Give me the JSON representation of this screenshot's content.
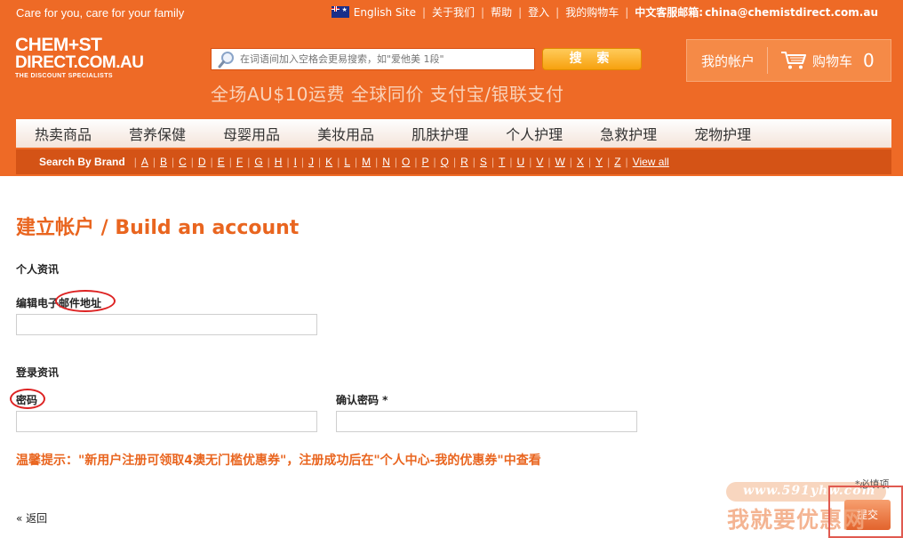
{
  "header": {
    "tagline": "Care for you, care for your family",
    "top_links": {
      "english_site": "English Site",
      "about": "关于我们",
      "help": "帮助",
      "login": "登入",
      "my_cart": "我的购物车",
      "cn_service_label": "中文客服邮箱:",
      "cn_service_email": "china@chemistdirect.com.au"
    },
    "logo": {
      "line1": "CHEM+ST",
      "line2": "DIRECT.COM.AU",
      "line3": "THE DISCOUNT SPECIALISTS"
    },
    "search": {
      "placeholder": "在词语间加入空格会更易搜索，如\"爱他美 1段\"",
      "button_label": "搜 索"
    },
    "promo": "全场AU$10运费  全球同价  支付宝/银联支付",
    "account": {
      "my_account": "我的帐户",
      "cart": "购物车",
      "cart_count": "0"
    }
  },
  "nav": {
    "items": [
      "热卖商品",
      "营养保健",
      "母婴用品",
      "美妆用品",
      "肌肤护理",
      "个人护理",
      "急救护理",
      "宠物护理"
    ]
  },
  "brand_bar": {
    "title": "Search By Brand",
    "letters": [
      "A",
      "B",
      "C",
      "D",
      "E",
      "F",
      "G",
      "H",
      "I",
      "J",
      "K",
      "L",
      "M",
      "N",
      "O",
      "P",
      "Q",
      "R",
      "S",
      "T",
      "U",
      "V",
      "W",
      "X",
      "Y",
      "Z"
    ],
    "view_all": "View all"
  },
  "form": {
    "title": "建立帐户 / Build an account",
    "personal_section": "个人资讯",
    "email_label": "编辑电子邮件地址",
    "login_section": "登录资讯",
    "password_label": "密码",
    "confirm_password_label": "确认密码 *",
    "notice": "温馨提示：\"新用户注册可领取4澳无门槛优惠券\"，注册成功后在\"个人中心-我的优惠券\"中查看",
    "required_note": "*必填项",
    "back_label": "« 返回",
    "submit_label": "提交"
  },
  "watermark": {
    "url": "www.591yhw.com",
    "text": "我就要优惠网"
  },
  "colors": {
    "brand_orange": "#ee6a26",
    "brand_bar": "#d45316",
    "title_orange": "#e9651f",
    "annotation_red": "#dd2222"
  }
}
